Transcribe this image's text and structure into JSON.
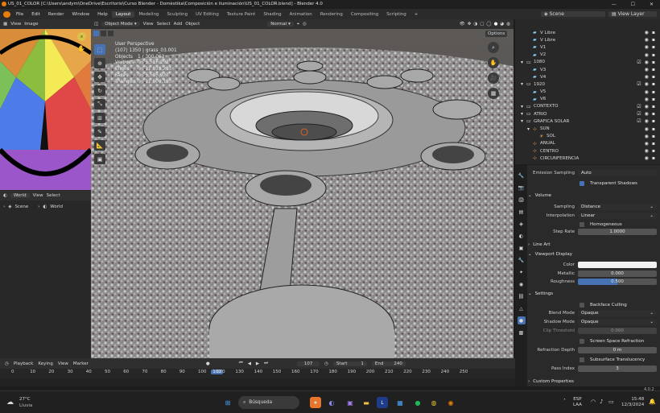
{
  "window": {
    "title": "US_01_COLOR [C:\\Users\\andym\\OneDrive\\Escritorio\\Curso Blender - Domèstika\\Composición e iluminación\\US_01_COLOR.blend] - Blender 4.0"
  },
  "menu": [
    "File",
    "Edit",
    "Render",
    "Window",
    "Help"
  ],
  "workspaces": [
    "Layout",
    "Modeling",
    "Sculpting",
    "UV Editing",
    "Texture Paint",
    "Shading",
    "Animation",
    "Rendering",
    "Compositing",
    "Scripting",
    "+"
  ],
  "active_workspace": "Layout",
  "scene": {
    "label": "Scene",
    "view_layer": "View Layer"
  },
  "image_editor": {
    "view": "View",
    "image": "Image"
  },
  "world_panel": {
    "world": "World",
    "view": "View",
    "select": "Select",
    "tree_scene": "Scene",
    "tree_world": "World"
  },
  "viewport_header": {
    "mode": "Object Mode",
    "view": "View",
    "select": "Select",
    "add": "Add",
    "object": "Object",
    "orientation": "Normal",
    "options": "Options"
  },
  "stats": {
    "title": "User Perspective",
    "subtitle": "(107) 1350 | grass_03.001",
    "rows": [
      {
        "k": "Objects",
        "v": "1 / 300,063"
      },
      {
        "k": "Vertices",
        "v": "0 / 5,516,292"
      },
      {
        "k": "Edges",
        "v": "0 / 11,018,291"
      },
      {
        "k": "Faces",
        "v": "0 / 5,505,927"
      },
      {
        "k": "Triangles",
        "v": "0 / 11,009,195"
      }
    ]
  },
  "outliner": [
    {
      "name": "V Libre",
      "indent": 2,
      "type": "cam",
      "checkbox": false
    },
    {
      "name": "V Libre",
      "indent": 2,
      "type": "cam",
      "checkbox": false
    },
    {
      "name": "V1",
      "indent": 2,
      "type": "cam",
      "checkbox": false
    },
    {
      "name": "V2",
      "indent": 2,
      "type": "cam",
      "checkbox": false
    },
    {
      "name": "1080",
      "indent": 1,
      "type": "coll",
      "checkbox": true
    },
    {
      "name": "V3",
      "indent": 2,
      "type": "cam",
      "checkbox": false
    },
    {
      "name": "V4",
      "indent": 2,
      "type": "cam",
      "checkbox": false
    },
    {
      "name": "1920",
      "indent": 1,
      "type": "coll",
      "checkbox": true
    },
    {
      "name": "V5",
      "indent": 2,
      "type": "cam",
      "checkbox": false
    },
    {
      "name": "V6",
      "indent": 2,
      "type": "cam",
      "checkbox": false
    },
    {
      "name": "CONTEXTO",
      "indent": 1,
      "type": "coll",
      "checkbox": true
    },
    {
      "name": "ATRIO",
      "indent": 1,
      "type": "coll",
      "checkbox": true
    },
    {
      "name": "GRAFICA SOLAR",
      "indent": 1,
      "type": "coll",
      "checkbox": true
    },
    {
      "name": "SUN",
      "indent": 2,
      "type": "obj",
      "checkbox": false
    },
    {
      "name": "SOL",
      "indent": 3,
      "type": "light",
      "checkbox": false
    },
    {
      "name": "ANUAL",
      "indent": 2,
      "type": "obj",
      "checkbox": false
    },
    {
      "name": "CENTRO",
      "indent": 2,
      "type": "obj",
      "checkbox": false
    },
    {
      "name": "CIRCUNFERENCIA",
      "indent": 2,
      "type": "obj",
      "checkbox": false
    }
  ],
  "properties": {
    "emission_sampling": "Emission Sampling",
    "emission_value": "Auto",
    "transparent_shadows": "Transparent Shadows",
    "volume": "Volume",
    "sampling_label": "Sampling",
    "sampling_value": "Distance",
    "interpolation_label": "Interpolation",
    "interpolation_value": "Linear",
    "homogeneous": "Homogeneous",
    "step_rate_label": "Step Rate",
    "step_rate_value": "1.0000",
    "line_art": "Line Art",
    "viewport_display": "Viewport Display",
    "color_label": "Color",
    "metallic_label": "Metallic",
    "metallic_value": "0.000",
    "roughness_label": "Roughness",
    "roughness_value": "0.500",
    "settings": "Settings",
    "backface_culling": "Backface Culling",
    "blend_mode_label": "Blend Mode",
    "blend_mode_value": "Opaque",
    "shadow_mode_label": "Shadow Mode",
    "shadow_mode_value": "Opaque",
    "clip_threshold_label": "Clip Threshold",
    "clip_threshold_value": "0.000",
    "ssr": "Screen Space Refraction",
    "refraction_depth_label": "Refraction Depth",
    "refraction_depth_value": "0 m",
    "subsurface": "Subsurface Translucency",
    "pass_index_label": "Pass Index",
    "pass_index_value": "3",
    "custom_properties": "Custom Properties",
    "version": "4.0.2"
  },
  "timeline": {
    "playback": "Playback",
    "keying": "Keying",
    "view": "View",
    "marker": "Marker",
    "current_frame": "107",
    "start_label": "Start",
    "start": "1",
    "end_label": "End",
    "end": "240",
    "ticks": [
      "0",
      "10",
      "20",
      "30",
      "40",
      "50",
      "60",
      "70",
      "80",
      "90",
      "100",
      "107",
      "120",
      "130",
      "140",
      "150",
      "160",
      "170",
      "180",
      "190",
      "200",
      "210",
      "220",
      "230",
      "240",
      "250"
    ]
  },
  "taskbar": {
    "weather_temp": "27°C",
    "weather_desc": "Lluvia",
    "search": "Búsqueda",
    "lang": "ESP",
    "lang2": "LAA",
    "time": "15:48",
    "date": "12/3/2024"
  },
  "colors": {
    "accent": "#4772b3",
    "frame": "#4772b3"
  }
}
